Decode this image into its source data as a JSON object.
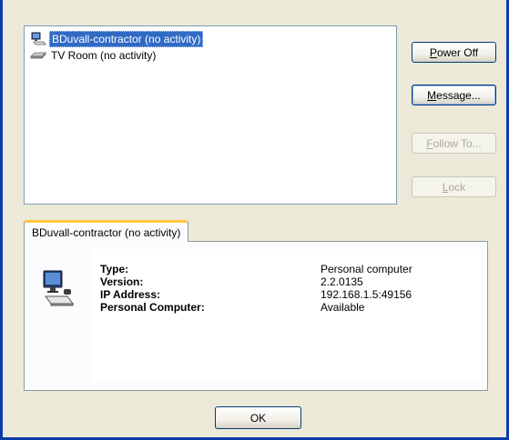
{
  "devices": [
    {
      "label": "BDuvall-contractor (no activity)",
      "selected": true,
      "icon": "computer-icon"
    },
    {
      "label": "TV Room (no activity)",
      "selected": false,
      "icon": "media-device-icon"
    }
  ],
  "buttons": {
    "power_off": {
      "accel": "P",
      "rest": "ower Off",
      "enabled": true
    },
    "message": {
      "accel": "M",
      "rest": "essage...",
      "enabled": true
    },
    "follow_to": {
      "accel": "F",
      "rest": "ollow To...",
      "enabled": false
    },
    "lock": {
      "accel": "L",
      "rest": "ock",
      "enabled": false
    },
    "ok": "OK"
  },
  "details": {
    "tab_label": "BDuvall-contractor (no activity)",
    "icon": "computer-icon",
    "fields": [
      {
        "label": "Type:",
        "value": "Personal computer"
      },
      {
        "label": "Version:",
        "value": "2.2.0135"
      },
      {
        "label": "IP Address:",
        "value": "192.168.1.5:49156"
      },
      {
        "label": "Personal Computer:",
        "value": "Available"
      }
    ]
  },
  "colors": {
    "selection": "#316ac5",
    "tab_highlight": "#ffc83c",
    "window_frame": "#0b3ca9"
  }
}
